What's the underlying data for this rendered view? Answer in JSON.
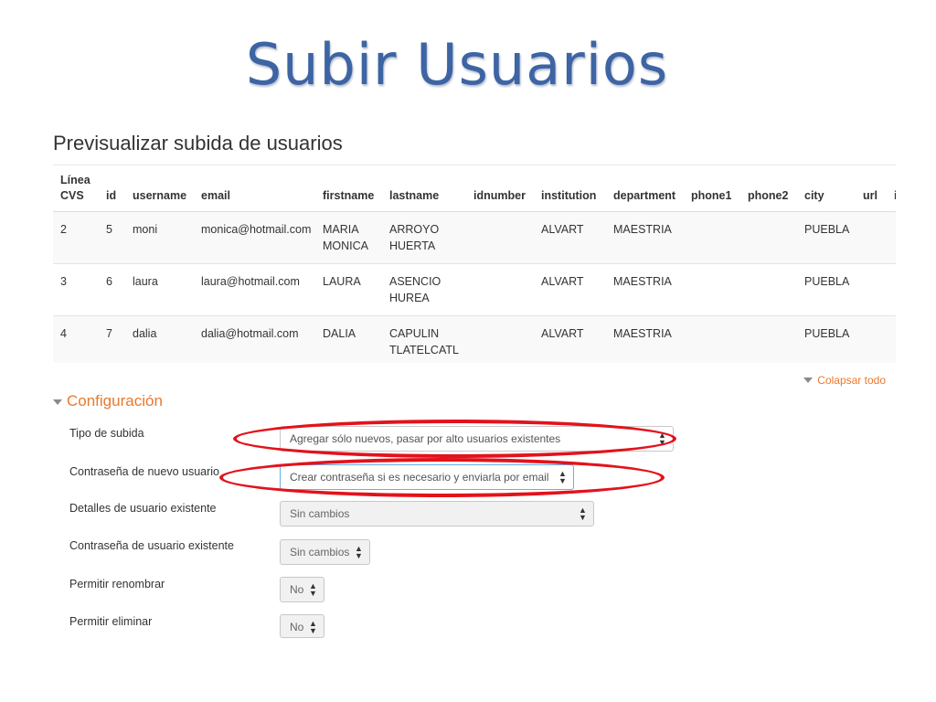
{
  "slide": {
    "title": "Subir Usuarios"
  },
  "preview": {
    "heading": "Previsualizar subida de usuarios",
    "columns": [
      "Línea CVS",
      "id",
      "username",
      "email",
      "firstname",
      "lastname",
      "idnumber",
      "institution",
      "department",
      "phone1",
      "phone2",
      "city",
      "url",
      "i"
    ],
    "rows": [
      [
        "2",
        "5",
        "moni",
        "monica@hotmail.com",
        "MARIA MONICA",
        "ARROYO HUERTA",
        "",
        "ALVART",
        "MAESTRIA",
        "",
        "",
        "PUEBLA",
        "",
        ""
      ],
      [
        "3",
        "6",
        "laura",
        "laura@hotmail.com",
        "LAURA",
        "ASENCIO HUREA",
        "",
        "ALVART",
        "MAESTRIA",
        "",
        "",
        "PUEBLA",
        "",
        ""
      ],
      [
        "4",
        "7",
        "dalia",
        "dalia@hotmail.com",
        "DALIA",
        "CAPULIN TLATELCATL",
        "",
        "ALVART",
        "MAESTRIA",
        "",
        "",
        "PUEBLA",
        "",
        ""
      ]
    ]
  },
  "collapse_all": "Colapsar todo",
  "config": {
    "title": "Configuración",
    "fields": [
      {
        "label": "Tipo de subida",
        "value": "Agregar sólo nuevos, pasar por alto usuarios existentes"
      },
      {
        "label": "Contraseña de nuevo usuario",
        "value": "Crear contraseña si es necesario y enviarla por email"
      },
      {
        "label": "Detalles de usuario existente",
        "value": "Sin cambios"
      },
      {
        "label": "Contraseña de usuario existente",
        "value": "Sin cambios"
      },
      {
        "label": "Permitir renombrar",
        "value": "No"
      },
      {
        "label": "Permitir eliminar",
        "value": "No"
      }
    ]
  },
  "colors": {
    "title": "#3d64a3",
    "accent": "#e8792e",
    "annotation": "#e3121b"
  },
  "icons": {
    "select_arrow": "up-down-caret-icon",
    "collapse": "triangle-down-icon"
  }
}
